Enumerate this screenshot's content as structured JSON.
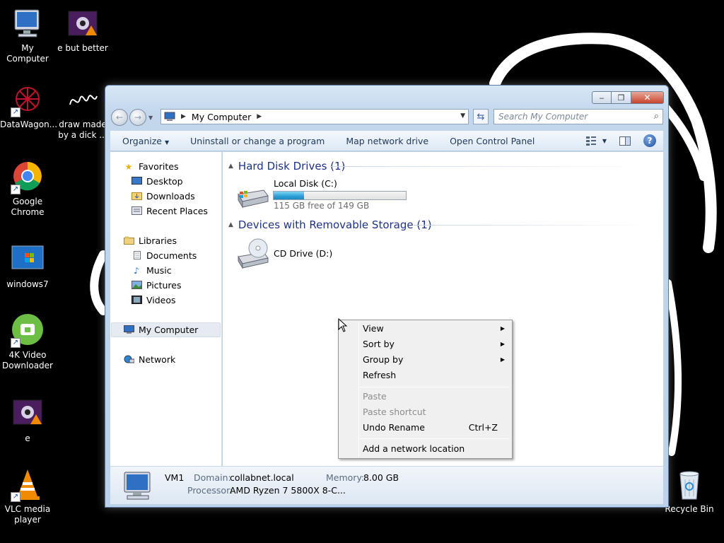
{
  "desktop": {
    "icons": [
      {
        "label": "My Computer",
        "icon": "computer-icon"
      },
      {
        "label": "e but better",
        "icon": "video-file-icon"
      },
      {
        "label": "DataWagon...",
        "icon": "datawagon-icon"
      },
      {
        "label": "draw made by a dick ...",
        "icon": "drawing-file-icon"
      },
      {
        "label": "Google Chrome",
        "icon": "chrome-icon"
      },
      {
        "label": "windows7",
        "icon": "image-file-icon"
      },
      {
        "label": "4K Video Downloader",
        "icon": "video-downloader-icon"
      },
      {
        "label": "e",
        "icon": "video-file-icon"
      },
      {
        "label": "VLC media player",
        "icon": "vlc-icon"
      },
      {
        "label": "Recycle Bin",
        "icon": "recycle-bin-icon"
      }
    ]
  },
  "window": {
    "address": {
      "location": "My Computer"
    },
    "search": {
      "placeholder": "Search My Computer"
    },
    "command_bar": {
      "items": [
        "Organize",
        "Uninstall or change a program",
        "Map network drive",
        "Open Control Panel"
      ]
    },
    "navigation": {
      "favorites": {
        "label": "Favorites",
        "items": [
          "Desktop",
          "Downloads",
          "Recent Places"
        ]
      },
      "libraries": {
        "label": "Libraries",
        "items": [
          "Documents",
          "Music",
          "Pictures",
          "Videos"
        ]
      },
      "computer": {
        "label": "My Computer"
      },
      "network": {
        "label": "Network"
      }
    },
    "content": {
      "hard_disk_group": "Hard Disk Drives (1)",
      "local_disk": {
        "name": "Local Disk (C:)",
        "free_text": "115 GB free of 149 GB",
        "used_fraction": 0.228
      },
      "removable_group": "Devices with Removable Storage (1)",
      "cd_drive": {
        "name": "CD Drive (D:)"
      }
    },
    "details": {
      "name": "VM1",
      "domain_label": "Domain:",
      "domain_value": "collabnet.local",
      "memory_label": "Memory:",
      "memory_value": "8.00 GB",
      "processor_label": "Processor:",
      "processor_value": "AMD Ryzen 7 5800X 8-C..."
    }
  },
  "context_menu": {
    "items": [
      {
        "label": "View",
        "submenu": true,
        "enabled": true
      },
      {
        "label": "Sort by",
        "submenu": true,
        "enabled": true
      },
      {
        "label": "Group by",
        "submenu": true,
        "enabled": true
      },
      {
        "label": "Refresh",
        "enabled": true
      },
      {
        "label": "Paste",
        "enabled": false
      },
      {
        "label": "Paste shortcut",
        "enabled": false
      },
      {
        "label": "Undo Rename",
        "shortcut": "Ctrl+Z",
        "enabled": true
      },
      {
        "label": "Add a network location",
        "enabled": true
      }
    ]
  }
}
